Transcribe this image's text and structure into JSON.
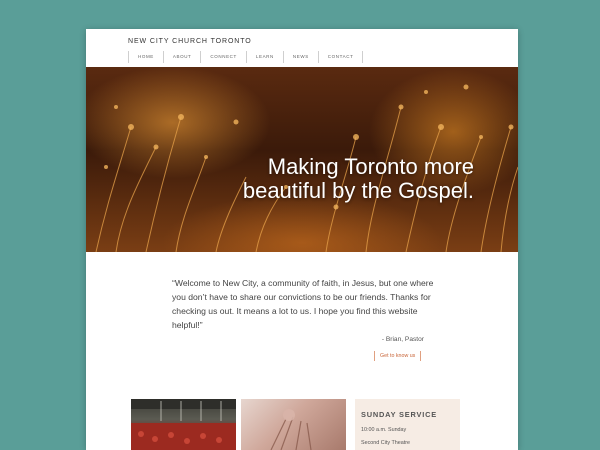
{
  "header": {
    "logo": "NEW CITY CHURCH TORONTO",
    "nav": [
      "HOME",
      "ABOUT",
      "CONNECT",
      "LEARN",
      "NEWS",
      "CONTACT"
    ]
  },
  "hero": {
    "title": "Making Toronto more beautiful by the Gospel."
  },
  "welcome": {
    "quote": "“Welcome to New City, a community of faith, in Jesus, but one where you don’t have to share our convictions to be our friends. Thanks for checking us out. It means a lot to us. I hope you find this website helpful!”",
    "signature": "- Brian, Pastor",
    "button": "Get to know us"
  },
  "service": {
    "title": "SUNDAY SERVICE",
    "time": "10:00 a.m. Sunday",
    "venue": "Second City Theatre"
  },
  "colors": {
    "background": "#5a9e98",
    "accent": "#c9663a",
    "service_bg": "#f6ece4"
  }
}
